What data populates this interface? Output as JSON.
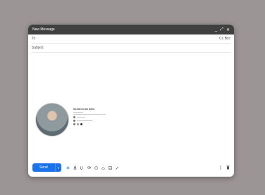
{
  "compose": {
    "title": "New Message",
    "window_controls": {
      "minimize": "_",
      "expand": "⤢",
      "close": "✕"
    },
    "to_label": "To",
    "cc_bcc": "Cc Bcc",
    "subject_placeholder": "Subject",
    "signature": {
      "name": "MAURICIO DE BÉNI"
    },
    "send_label": "Send",
    "send_dropdown": "▾"
  },
  "colors": {
    "titlebar": "#404040",
    "send_button": "#1a73e8",
    "background": "#9c9595"
  },
  "icons": {
    "toolbar": [
      "text-formatting-icon",
      "attach-icon",
      "link-icon",
      "emoji-icon",
      "drive-icon",
      "photo-icon",
      "pen-icon",
      "lock-icon",
      "more-options-icon",
      "trash-icon"
    ]
  }
}
